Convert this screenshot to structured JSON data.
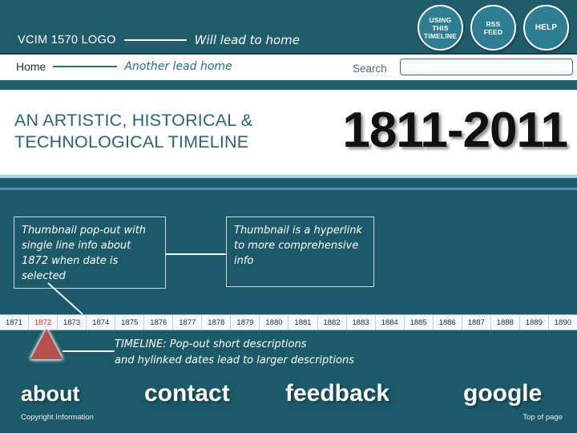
{
  "header": {
    "logo_text": "VCIM 1570 LOGO",
    "logo_lead_note": "Will lead to home",
    "buttons": [
      {
        "name": "using-this-timeline",
        "lines": [
          "USING",
          "THIS",
          "TIMELINE"
        ]
      },
      {
        "name": "rss-feed",
        "lines": [
          "RSS",
          "FEED"
        ]
      },
      {
        "name": "help",
        "lines": [
          "HELP"
        ]
      }
    ]
  },
  "nav": {
    "home_label": "Home",
    "home_lead_note": "Another lead home",
    "search_label": "Search",
    "search_value": "",
    "search_placeholder": ""
  },
  "title": {
    "heading": "AN ARTISTIC, HISTORICAL & TECHNOLOGICAL TIMELINE",
    "years": "1811-2011"
  },
  "callouts": [
    {
      "id": "thumbnail-popout",
      "text": "Thumbnail pop-out with single line info about 1872 when date is selected"
    },
    {
      "id": "thumbnail-hyperlink",
      "text": "Thumbnail is a hyperlink to more comprehensive info"
    }
  ],
  "timeline": {
    "years": [
      "1871",
      "1872",
      "1873",
      "1874",
      "1875",
      "1876",
      "1877",
      "1878",
      "1879",
      "1880",
      "1881",
      "1882",
      "1883",
      "1884",
      "1885",
      "1886",
      "1887",
      "1888",
      "1889",
      "1890"
    ],
    "selected_year": "1872",
    "note": "TIMELINE:  Pop-out short descriptions\nand hylinked dates lead to larger descriptions"
  },
  "footer": {
    "about": "about",
    "contact": "contact",
    "feedback": "feedback",
    "google": "google",
    "copyright": "Copyright Information",
    "top_of_page": "Top of page"
  },
  "colors": {
    "body_teal": "#1d5a69",
    "header_teal": "#215c6b",
    "circle_fill": "#2d7e92",
    "title_teal": "#2c6272",
    "selected_year_red": "#e02a22",
    "marker_red": "#b5504f",
    "divider_light_blue": "#a9d3e0"
  }
}
